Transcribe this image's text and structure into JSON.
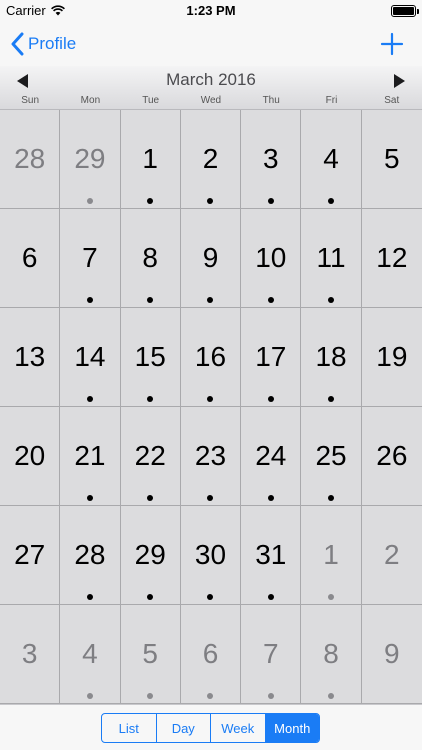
{
  "status_bar": {
    "carrier": "Carrier",
    "time": "1:23 PM"
  },
  "nav": {
    "back_label": "Profile",
    "add_icon": "plus-icon"
  },
  "calendar": {
    "month_title": "March 2016",
    "weekdays": [
      "Sun",
      "Mon",
      "Tue",
      "Wed",
      "Thu",
      "Fri",
      "Sat"
    ],
    "days": [
      {
        "day": "28",
        "current": false,
        "event": false
      },
      {
        "day": "29",
        "current": false,
        "event": true
      },
      {
        "day": "1",
        "current": true,
        "event": true
      },
      {
        "day": "2",
        "current": true,
        "event": true
      },
      {
        "day": "3",
        "current": true,
        "event": true
      },
      {
        "day": "4",
        "current": true,
        "event": true
      },
      {
        "day": "5",
        "current": true,
        "event": false
      },
      {
        "day": "6",
        "current": true,
        "event": false
      },
      {
        "day": "7",
        "current": true,
        "event": true
      },
      {
        "day": "8",
        "current": true,
        "event": true
      },
      {
        "day": "9",
        "current": true,
        "event": true
      },
      {
        "day": "10",
        "current": true,
        "event": true
      },
      {
        "day": "11",
        "current": true,
        "event": true
      },
      {
        "day": "12",
        "current": true,
        "event": false
      },
      {
        "day": "13",
        "current": true,
        "event": false
      },
      {
        "day": "14",
        "current": true,
        "event": true
      },
      {
        "day": "15",
        "current": true,
        "event": true
      },
      {
        "day": "16",
        "current": true,
        "event": true
      },
      {
        "day": "17",
        "current": true,
        "event": true
      },
      {
        "day": "18",
        "current": true,
        "event": true
      },
      {
        "day": "19",
        "current": true,
        "event": false
      },
      {
        "day": "20",
        "current": true,
        "event": false
      },
      {
        "day": "21",
        "current": true,
        "event": true
      },
      {
        "day": "22",
        "current": true,
        "event": true
      },
      {
        "day": "23",
        "current": true,
        "event": true
      },
      {
        "day": "24",
        "current": true,
        "event": true
      },
      {
        "day": "25",
        "current": true,
        "event": true
      },
      {
        "day": "26",
        "current": true,
        "event": false
      },
      {
        "day": "27",
        "current": true,
        "event": false
      },
      {
        "day": "28",
        "current": true,
        "event": true
      },
      {
        "day": "29",
        "current": true,
        "event": true
      },
      {
        "day": "30",
        "current": true,
        "event": true
      },
      {
        "day": "31",
        "current": true,
        "event": true
      },
      {
        "day": "1",
        "current": false,
        "event": true
      },
      {
        "day": "2",
        "current": false,
        "event": false
      },
      {
        "day": "3",
        "current": false,
        "event": false
      },
      {
        "day": "4",
        "current": false,
        "event": true
      },
      {
        "day": "5",
        "current": false,
        "event": true
      },
      {
        "day": "6",
        "current": false,
        "event": true
      },
      {
        "day": "7",
        "current": false,
        "event": true
      },
      {
        "day": "8",
        "current": false,
        "event": true
      },
      {
        "day": "9",
        "current": false,
        "event": false
      }
    ]
  },
  "view_switcher": {
    "options": [
      "List",
      "Day",
      "Week",
      "Month"
    ],
    "selected": "Month"
  },
  "colors": {
    "accent": "#1a7cf5",
    "grid_background": "#dcdcde",
    "other_month_text": "#7e7e82"
  }
}
